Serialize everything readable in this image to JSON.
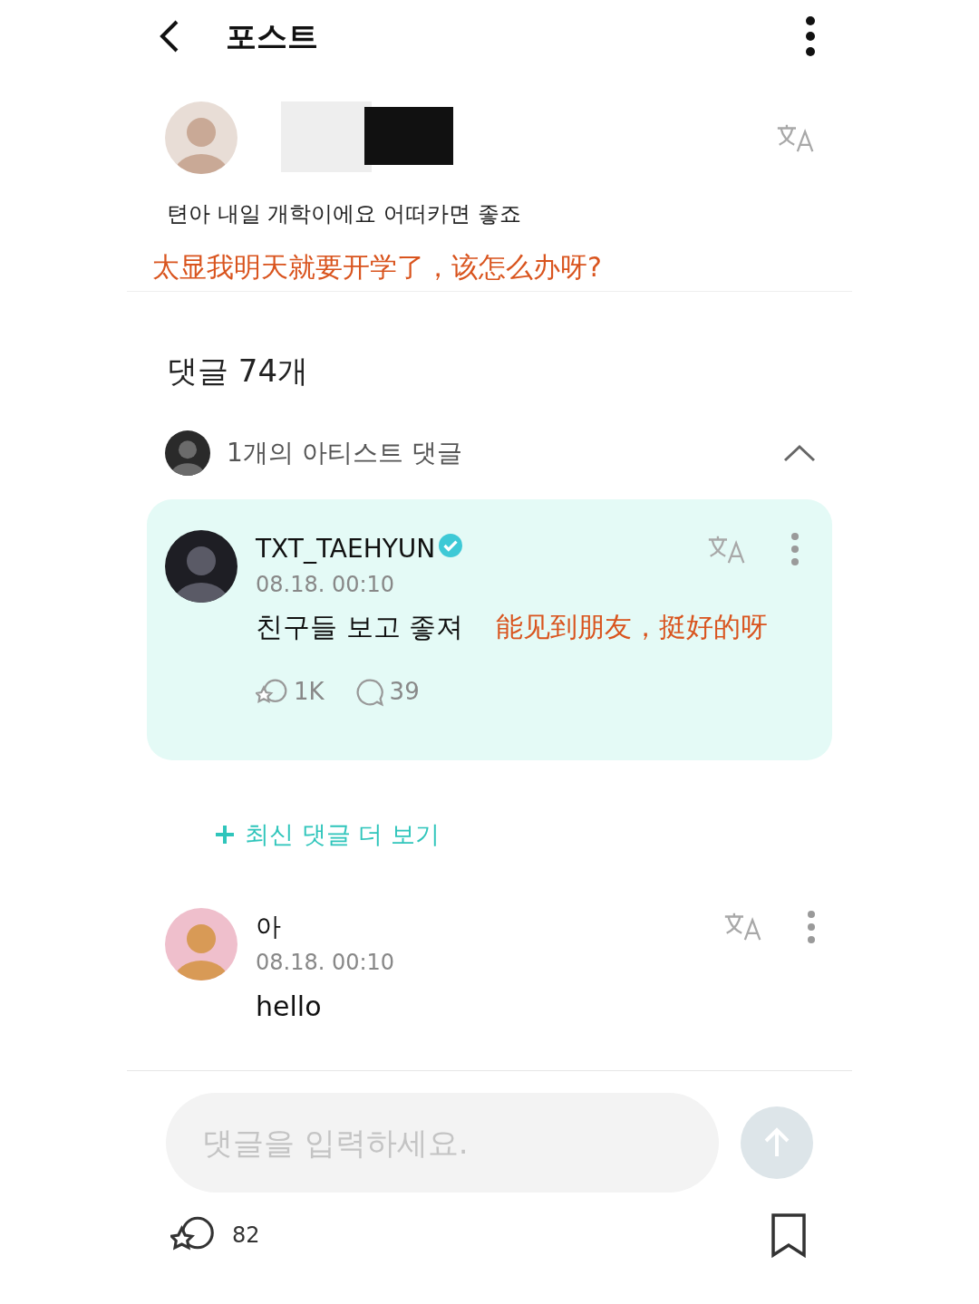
{
  "header": {
    "title": "포스트"
  },
  "post": {
    "author_hidden": true,
    "body": "텬아 내일 개학이에요 어떠카면 좋죠",
    "annotation": "太显我明天就要开学了，该怎么办呀?"
  },
  "comments_title": "댓글 74개",
  "artist_section": {
    "label": "1개의 아티스트 댓글",
    "expanded": true,
    "comment": {
      "name": "TXT_TAEHYUN",
      "verified": true,
      "date": "08.18. 00:10",
      "body": "친구들 보고 좋져",
      "annotation": "能见到朋友，挺好的呀",
      "likes": "1K",
      "replies": "39"
    }
  },
  "more_link": "최신 댓글 더 보기",
  "comments": [
    {
      "name": "아",
      "date": "08.18. 00:10",
      "body": "hello"
    }
  ],
  "input": {
    "placeholder": "댓글을 입력하세요."
  },
  "footer": {
    "likes": "82"
  }
}
